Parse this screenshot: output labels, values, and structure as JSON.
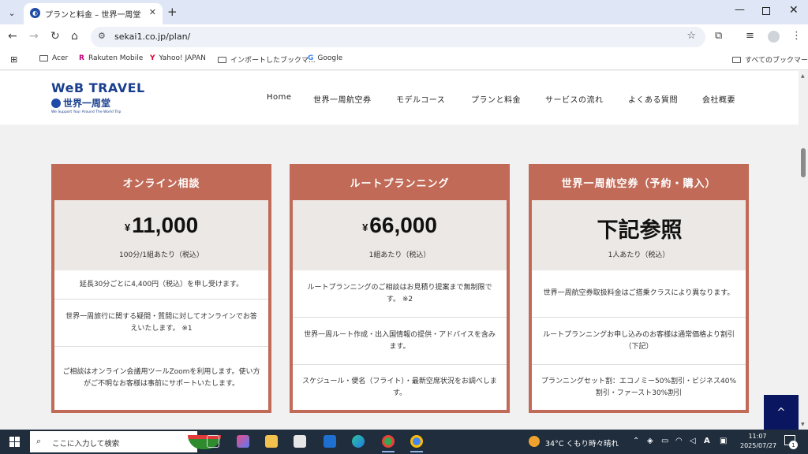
{
  "browser": {
    "tab_title": "プランと料金 – 世界一周堂",
    "tab_close": "✕",
    "new_tab": "+",
    "url": "sekai1.co.jp/plan/",
    "bookmarks": [
      {
        "label": "Acer"
      },
      {
        "label": "Rakuten Mobile"
      },
      {
        "label": "Yahoo! JAPAN"
      },
      {
        "label": "インポートしたブックマ..."
      },
      {
        "label": "Google"
      }
    ],
    "all_bookmarks": "すべてのブックマーク"
  },
  "site": {
    "logo_top": "WeB TRAVEL",
    "logo_mid": "世界一周堂",
    "logo_sub": "We Support Your Around The World Trip",
    "nav": [
      "Home",
      "世界一周航空券",
      "モデルコース",
      "プランと料金",
      "サービスの流れ",
      "よくある質問",
      "会社概要"
    ]
  },
  "cards": [
    {
      "title": "オンライン相談",
      "currency": "¥",
      "price": "11,000",
      "note": "100分/1組あたり（税込）",
      "rows": [
        "延長30分ごとに4,400円（税込）を申し受けます。",
        "世界一周旅行に関する疑問・質問に対してオンラインでお答えいたします。 ※1",
        "ご相談はオンライン会議用ツールZoomを利用します。使い方がご不明なお客様は事前にサポートいたします。"
      ]
    },
    {
      "title": "ルートプランニング",
      "currency": "¥",
      "price": "66,000",
      "note": "1組あたり（税込）",
      "rows": [
        "ルートプランニングのご相談はお見積り提案まで無制限です。 ※2",
        "世界一周ルート作成・出入国情報の提供・アドバイスを含みます。",
        "スケジュール・便名（フライト）・最新空席状況をお調べします。"
      ]
    },
    {
      "title": "世界一周航空券（予約・購入）",
      "currency": "",
      "price": "下記参照",
      "note": "1人あたり（税込）",
      "rows": [
        "世界一周航空券取扱料金はご搭乗クラスにより異なります。",
        "ルートプランニングお申し込みのお客様は通常価格より割引（下記）",
        "プランニングセット割：エコノミー50%割引・ビジネス40%割引・ファースト30%割引"
      ]
    }
  ],
  "to_top": "^",
  "taskbar": {
    "search_placeholder": "ここに入力して検索",
    "weather": "34°C くもり時々晴れ",
    "ime": "A",
    "time": "11:07",
    "date": "2025/07/27",
    "notification_count": "1"
  }
}
